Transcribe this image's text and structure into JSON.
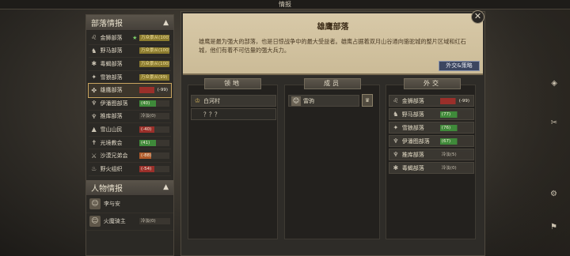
{
  "window_title": "情报",
  "left_panel": {
    "tribe_section_title": "部落情报",
    "tribes": [
      {
        "name": "金狮部落",
        "star": "★",
        "relation": "万众景从(100)",
        "style": "gold",
        "icon": "lion-icon"
      },
      {
        "name": "野马部落",
        "star": "",
        "relation": "万众景从(100)",
        "style": "gold",
        "icon": "horse-icon"
      },
      {
        "name": "毒蝎部落",
        "star": "",
        "relation": "万众景从(100)",
        "style": "gold",
        "icon": "scorpion-icon"
      },
      {
        "name": "雪狼部落",
        "star": "",
        "relation": "万众景从(99)",
        "style": "gold",
        "icon": "wolf-icon"
      },
      {
        "name": "雄鹰部落",
        "star": "",
        "relation": "(-99)",
        "style": "red",
        "icon": "eagle-icon"
      },
      {
        "name": "伊潘图部落",
        "star": "",
        "relation": "(40)",
        "style": "green",
        "icon": "tribe-icon"
      },
      {
        "name": "推库部落",
        "star": "",
        "relation": "冷淡(0)",
        "style": "neutral",
        "icon": "tribe-icon"
      },
      {
        "name": "雪山山民",
        "star": "",
        "relation": "(-40)",
        "style": "red",
        "icon": "mountain-icon"
      },
      {
        "name": "光境教会",
        "star": "",
        "relation": "(41)",
        "style": "green",
        "icon": "church-icon"
      },
      {
        "name": "沙漠兄弟会",
        "star": "",
        "relation": "(-88)",
        "style": "orange",
        "icon": "swords-icon"
      },
      {
        "name": "野火组织",
        "star": "",
        "relation": "(-54)",
        "style": "red",
        "icon": "fire-icon"
      }
    ],
    "people_section_title": "人物情报",
    "people": [
      {
        "name": "李与安",
        "relation": ""
      },
      {
        "name": "火魔骑主",
        "relation": "冷淡(0)"
      }
    ]
  },
  "dialog": {
    "title": "雄鹰部落",
    "description": "雄鹰是最为强大的部落，也是日惊战争中的最大受益者。雄鹰占据着双月山谷通向骆驼城的整片区域和红石城，他们有着不可估量的强大兵力。",
    "diplomacy_button": "外交&策略",
    "territory_header": "领地",
    "territories": [
      "白河村",
      "？？？"
    ],
    "members_header": "成员",
    "members": [
      {
        "name": "雷驹"
      }
    ],
    "leader_badge": "♛",
    "diplomacy_header": "外交",
    "relations": [
      {
        "name": "金狮部落",
        "value": "(-99)",
        "style": "red",
        "icon": "lion-icon"
      },
      {
        "name": "野马部落",
        "value": "(77)",
        "style": "green",
        "icon": "horse-icon"
      },
      {
        "name": "雪狼部落",
        "value": "(76)",
        "style": "green",
        "icon": "wolf-icon"
      },
      {
        "name": "伊潘图部落",
        "value": "(67)",
        "style": "green",
        "icon": "tribe-icon"
      },
      {
        "name": "推库部落",
        "value": "冷淡(5)",
        "style": "neutral",
        "icon": "tribe-icon"
      },
      {
        "name": "毒蝎部落",
        "value": "冷淡(0)",
        "style": "neutral",
        "icon": "scorpion-icon"
      }
    ],
    "close_label": "✕"
  }
}
